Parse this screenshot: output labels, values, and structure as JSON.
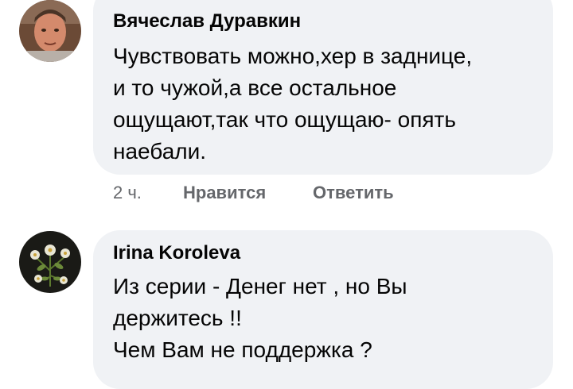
{
  "comments": [
    {
      "author": "Вячеслав Дуравкин",
      "text": "Чувствовать можно,хер в заднице,\nи то чужой,а все остальное\nощущают,так что ощущаю- опять\nнаебали.",
      "time": "2 ч.",
      "like_label": "Нравится",
      "reply_label": "Ответить"
    },
    {
      "author": "Irina Koroleva",
      "text": "Из серии - Денег нет , но Вы\nдержитесь !!\nЧем Вам не поддержка ?"
    }
  ],
  "colors": {
    "bubble": "#f0f2f5",
    "text": "#050505",
    "meta": "#65676b"
  }
}
